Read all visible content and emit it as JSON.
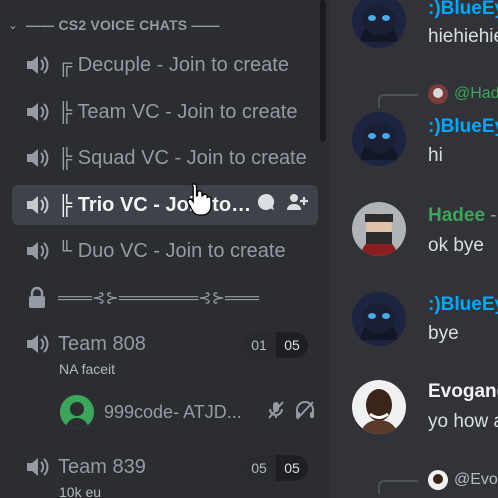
{
  "category": {
    "label": "—— CS2 VOICE CHATS ——"
  },
  "channels": [
    {
      "label": "╔ Decuple - Join to create"
    },
    {
      "label": "╠ Team VC - Join to create"
    },
    {
      "label": "╠ Squad VC - Join to create"
    },
    {
      "label": "╠ Trio VC - Join to create"
    },
    {
      "label": "╙ Duo VC - Join to create"
    },
    {
      "label": "═══⊰⊱═══════⊰⊱═══"
    }
  ],
  "voice_channels": [
    {
      "label": "Team 808",
      "status": "NA faceit",
      "user_count": "01",
      "user_limit": "05"
    },
    {
      "label": "Team 839",
      "status": "10k eu",
      "user_count": "05",
      "user_limit": "05"
    }
  ],
  "connected_user": {
    "name": "999code- ATJD..."
  },
  "messages": [
    {
      "author": ":)BlueEyes",
      "text": "hiehiehie",
      "color": "#00a8fc"
    },
    {
      "reply_to": "@Hadee",
      "author": ":)BlueEyes",
      "text": "hi",
      "color": "#00a8fc"
    },
    {
      "author": "Hadee",
      "dash": " - ",
      "text": "ok bye",
      "color": "#3ba55c"
    },
    {
      "author": ":)BlueEyes",
      "text": "bye",
      "color": "#00a8fc"
    },
    {
      "author": "Evogang",
      "text": "yo how are",
      "color": "#f2f3f5"
    },
    {
      "reply_to": "@Evogang"
    }
  ],
  "colors": {
    "sidebar_bg": "#2b2d31",
    "chat_bg": "#313338",
    "channel_text": "#949ba4",
    "active_bg": "#404249"
  }
}
